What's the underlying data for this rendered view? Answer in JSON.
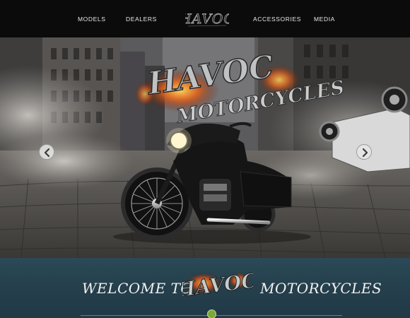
{
  "nav": {
    "items": [
      {
        "label": "MODELS"
      },
      {
        "label": "DEALERS"
      },
      {
        "label": "ACCESSORIES"
      },
      {
        "label": "MEDIA"
      }
    ],
    "logo_text": "HAVOC"
  },
  "hero": {
    "logo_text": "HAVOC",
    "title": "MOTORCYCLES",
    "prev_icon": "chevron-left-icon",
    "next_icon": "chevron-right-icon"
  },
  "welcome": {
    "prefix": "WELCOME TO",
    "logo_text": "HAVOC",
    "suffix": "MOTORCYCLES"
  },
  "colors": {
    "nav_bg": "#0b0b0b",
    "welcome_bg": "#253f4c",
    "flame_orange": "#e0631e",
    "accent_green": "#7aa83a"
  }
}
